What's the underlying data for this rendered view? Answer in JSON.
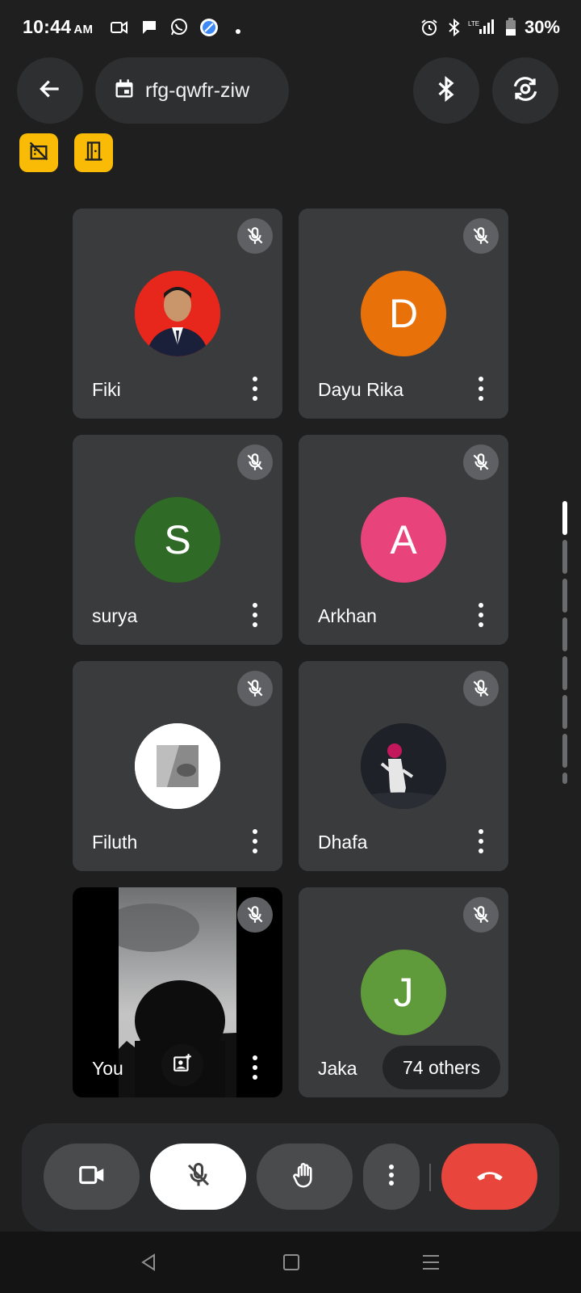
{
  "status_bar": {
    "time": "10:44",
    "ampm": "AM",
    "battery": "30%",
    "icons": [
      "video-notification-icon",
      "chat-icon",
      "whatsapp-icon",
      "browser-icon",
      "dot-icon",
      "alarm-icon",
      "bluetooth-icon",
      "lte-signal-icon",
      "battery-icon"
    ]
  },
  "header": {
    "meeting_code": "rfg-qwfr-ziw"
  },
  "participants": [
    {
      "name": "Fiki",
      "initial": "",
      "color": "#e8271c",
      "has_photo": true
    },
    {
      "name": "Dayu Rika",
      "initial": "D",
      "color": "#e8710a"
    },
    {
      "name": "surya",
      "initial": "S",
      "color": "#2f6b26"
    },
    {
      "name": "Arkhan",
      "initial": "A",
      "color": "#e8437a"
    },
    {
      "name": "Filuth",
      "initial": "",
      "color": "#ffffff",
      "has_photo": true
    },
    {
      "name": "Dhafa",
      "initial": "",
      "color": "#1e2228",
      "has_photo": true
    },
    {
      "name": "You",
      "initial": "",
      "self_view": true
    },
    {
      "name": "Jaka",
      "initial": "J",
      "color": "#5f9b3a"
    }
  ],
  "others_label": "74 others",
  "colors": {
    "background": "#1f1f1f",
    "tile": "#3a3b3d",
    "badge": "#f9bb05",
    "end_call": "#e8453c"
  }
}
